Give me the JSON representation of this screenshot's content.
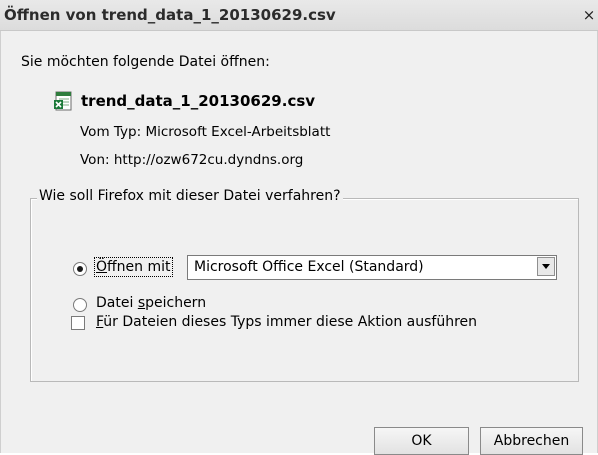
{
  "window": {
    "title": "Öffnen von trend_data_1_20130629.csv",
    "close_glyph": "×"
  },
  "prompt": "Sie möchten folgende Datei öffnen:",
  "file": {
    "name": "trend_data_1_20130629.csv",
    "icon": "excel-file-icon",
    "type_label": "Vom Typ:",
    "type_value": "Microsoft Excel-Arbeitsblatt",
    "from_label": "Von:",
    "from_value": "http://ozw672cu.dyndns.org"
  },
  "action_group": {
    "legend": "Wie soll Firefox mit dieser Datei verfahren?",
    "open_with": {
      "label_underlined": "Ö",
      "label_rest": "ffnen mit",
      "checked": true,
      "app": "Microsoft Office Excel (Standard)"
    },
    "save": {
      "label_before": "Datei ",
      "label_underlined": "s",
      "label_after": "peichern",
      "checked": false
    },
    "always": {
      "label_underlined": "F",
      "label_rest": "ür Dateien dieses Typs immer diese Aktion ausführen",
      "checked": false
    }
  },
  "buttons": {
    "ok": "OK",
    "cancel": "Abbrechen"
  },
  "colors": {
    "dialog_bg": "#f0f0f0",
    "excel_green": "#1d7a3a"
  }
}
